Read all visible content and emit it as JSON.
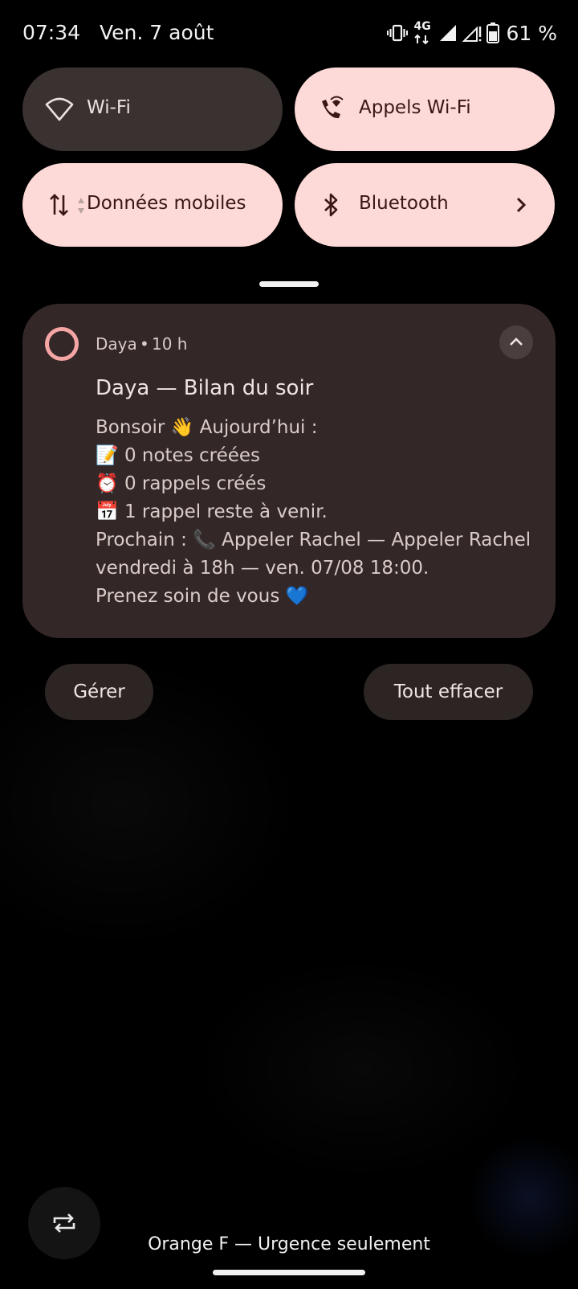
{
  "status_bar": {
    "time": "07:34",
    "date": "Ven. 7 août",
    "network_type": "4G",
    "battery": "61 %"
  },
  "quick_settings": {
    "tiles": [
      {
        "label": "Wi-Fi",
        "icon": "wifi-icon",
        "state": "off"
      },
      {
        "label": "Appels Wi-Fi",
        "icon": "wifi-calling-icon",
        "state": "on"
      },
      {
        "label": "Données mobiles",
        "icon": "mobile-data-icon",
        "state": "on"
      },
      {
        "label": "Bluetooth",
        "icon": "bluetooth-icon",
        "state": "on"
      }
    ]
  },
  "notification": {
    "app_name": "Daya",
    "separator": "•",
    "time": "10 h",
    "title": "Daya — Bilan du soir",
    "body_lines": [
      "Bonsoir 👋 Aujourd’hui :",
      "📝 0 notes créées",
      "⏰ 0 rappels créés",
      "📅 1 rappel reste à venir.",
      "Prochain : 📞 Appeler Rachel — Appeler Rachel",
      "vendredi à 18h — ven. 07/08 18:00.",
      "Prenez soin de vous 💙"
    ]
  },
  "actions": {
    "manage": "Gérer",
    "clear_all": "Tout effacer"
  },
  "carrier_text": "Orange F — Urgence seulement",
  "colors": {
    "tile_on": "#fdd9d7",
    "tile_off": "#3a3231",
    "notification_bg": "#332827",
    "app_icon_accent": "#f4a5a4"
  }
}
